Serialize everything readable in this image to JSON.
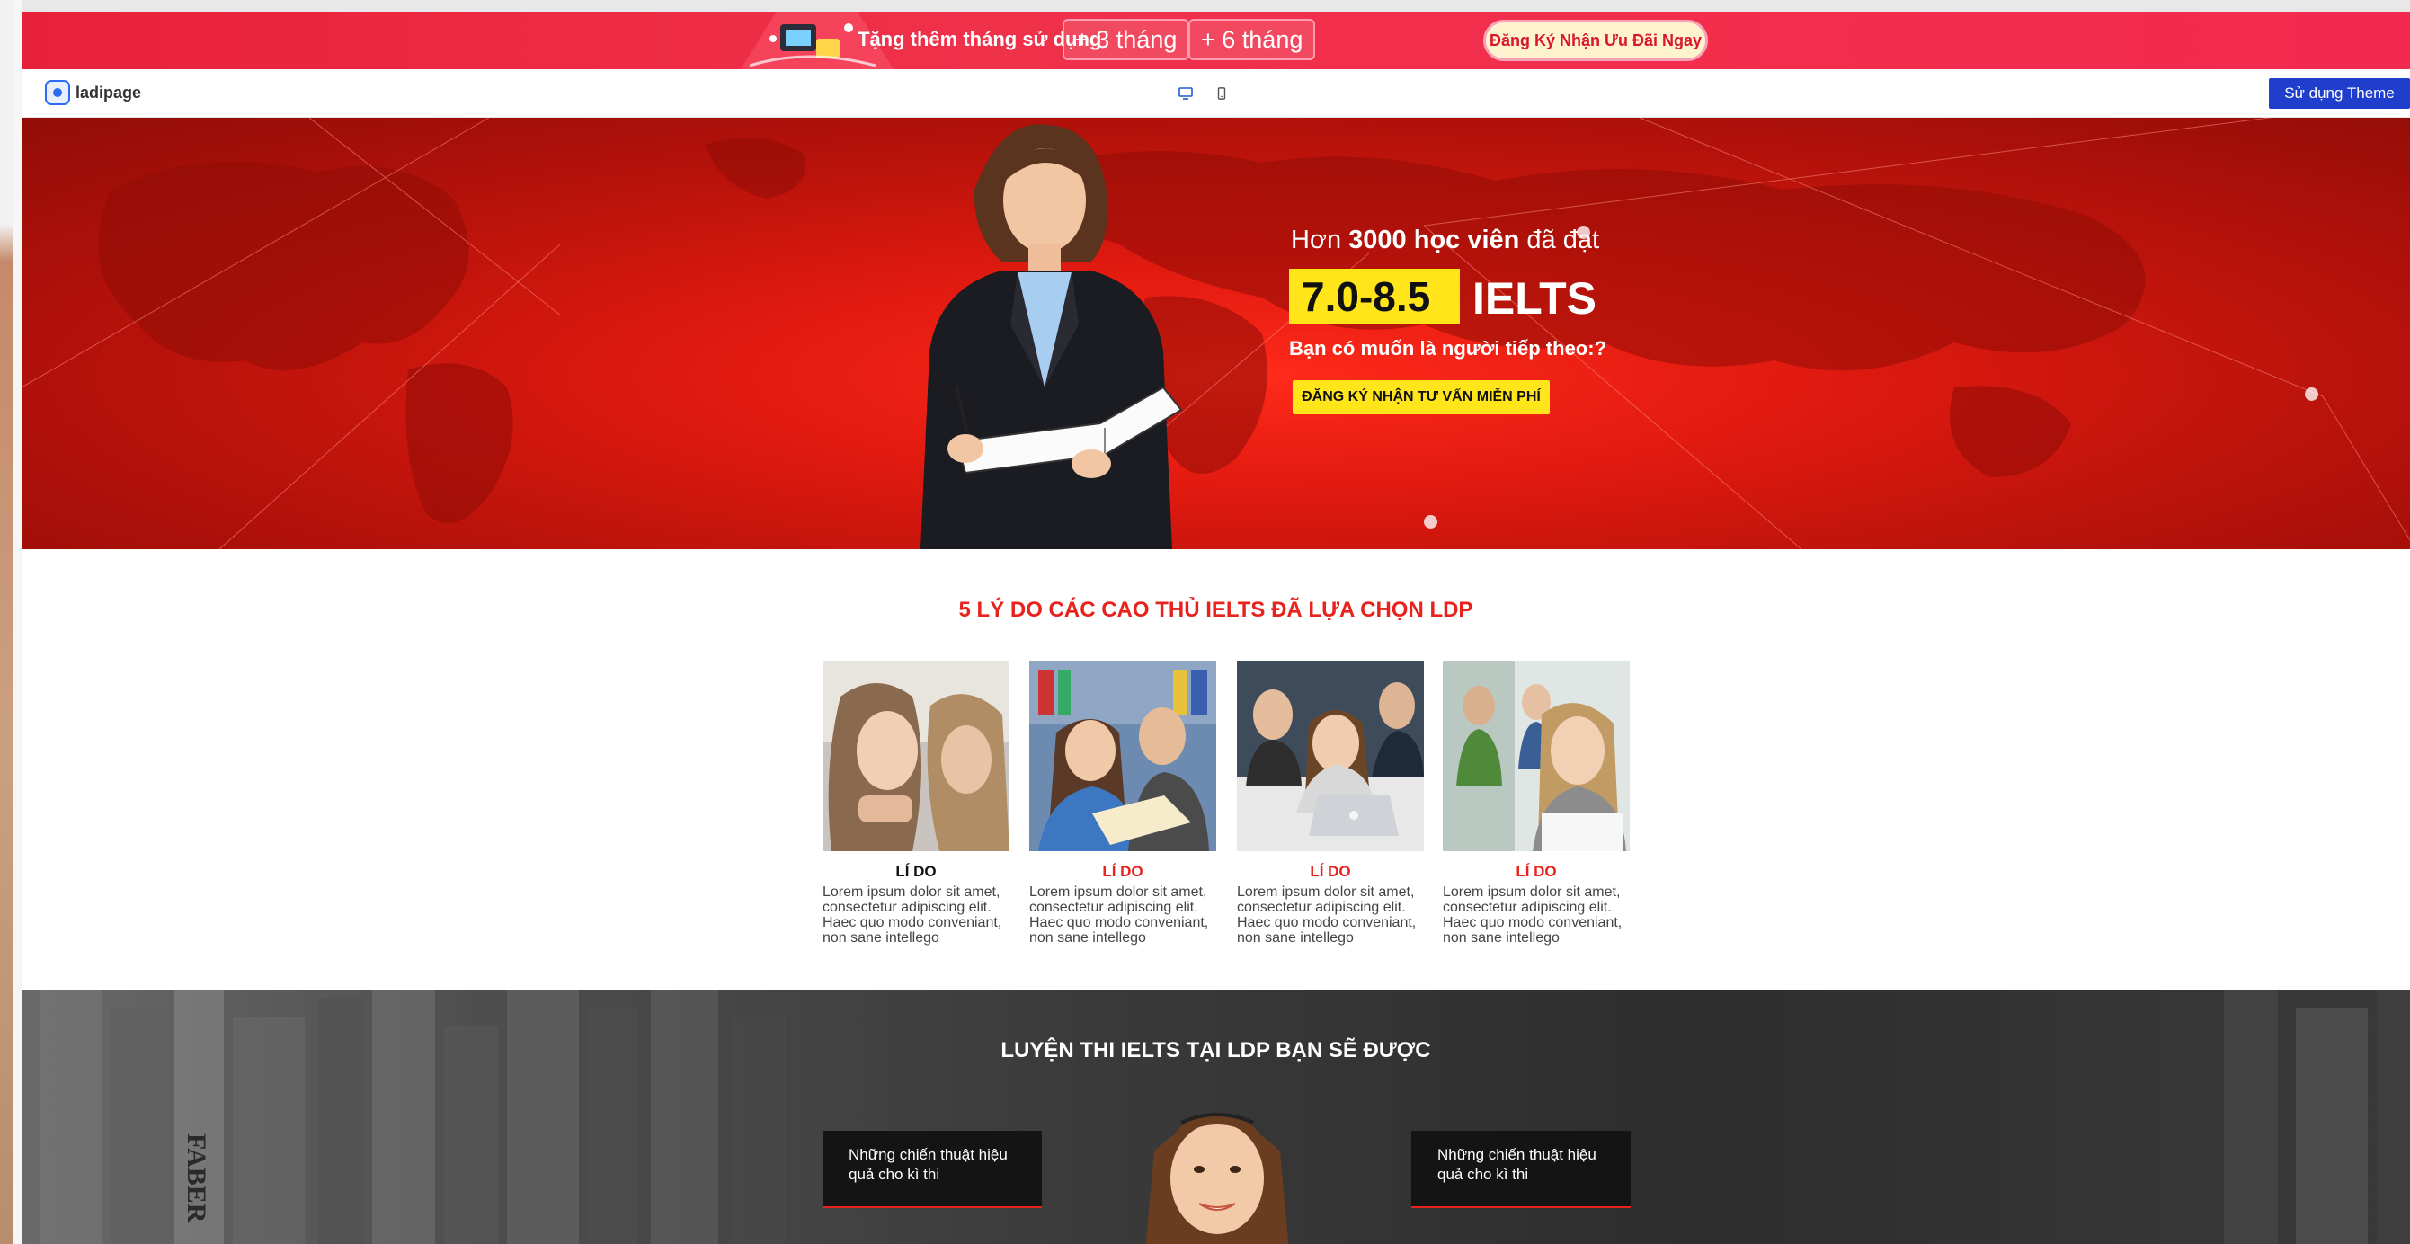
{
  "promo": {
    "text": "Tặng thêm tháng sử dụng",
    "pill1": "+ 3 tháng",
    "pill2": "+ 6 tháng",
    "cta": "Đăng Ký Nhận Ưu Đãi Ngay"
  },
  "toolbar": {
    "logo_text": "ladipage",
    "device_icons": [
      "desktop-icon",
      "mobile-icon"
    ],
    "use_theme": "Sử dụng Theme"
  },
  "hero": {
    "line1_prefix": "Hơn ",
    "line1_bold": "3000 học viên",
    "line1_suffix": " đã đạt",
    "score": "7.0-8.5",
    "exam": "IELTS",
    "question": "Bạn có muốn là người tiếp theo:?",
    "cta": "ĐĂNG KÝ NHẬN TƯ VẤN MIỄN PHÍ"
  },
  "reasons": {
    "title": "5 LÝ DO CÁC CAO THỦ IELTS ĐÃ LỰA CHỌN LDP",
    "cards": [
      {
        "title": "LÍ DO",
        "body": "Lorem ipsum dolor sit amet, consectetur adipiscing elit. Haec quo modo conveniant, non sane intellego"
      },
      {
        "title": "LÍ DO",
        "body": "Lorem ipsum dolor sit amet, consectetur adipiscing elit. Haec quo modo conveniant, non sane intellego"
      },
      {
        "title": "LÍ DO",
        "body": "Lorem ipsum dolor sit amet, consectetur adipiscing elit. Haec quo modo conveniant, non sane intellego"
      },
      {
        "title": "LÍ DO",
        "body": "Lorem ipsum dolor sit amet, consectetur adipiscing elit. Haec quo modo conveniant, non sane intellego"
      }
    ]
  },
  "benefits": {
    "title": "LUYỆN THI IELTS TẠI LDP BẠN SẼ ĐƯỢC",
    "items": [
      "Những chiến thuật hiệu quả cho kì thi",
      "Những chiến thuật hiệu quả cho kì thi"
    ]
  },
  "colors": {
    "promo_red": "#f0314a",
    "hero_red": "#e21a10",
    "accent_red": "#e8221d",
    "highlight_yellow": "#ffe51a",
    "theme_blue": "#1f3ecc"
  }
}
